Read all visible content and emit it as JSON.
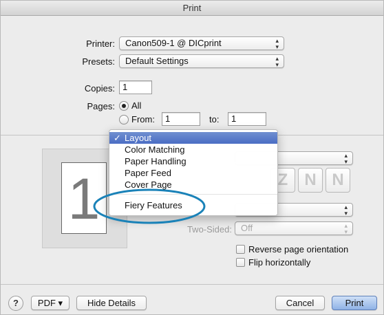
{
  "window": {
    "title": "Print"
  },
  "printer": {
    "label": "Printer:",
    "value": "Canon509-1 @ DICprint"
  },
  "presets": {
    "label": "Presets:",
    "value": "Default Settings"
  },
  "copies": {
    "label": "Copies:",
    "value": "1"
  },
  "pages": {
    "label": "Pages:",
    "all_label": "All",
    "from_label": "From:",
    "from_value": "1",
    "to_label": "to:",
    "to_value": "1",
    "selected": "All"
  },
  "preview": {
    "page_number": "1"
  },
  "section_menu": {
    "items": [
      {
        "label": "Layout",
        "checked": true,
        "checkmark": "✓"
      },
      {
        "label": "Color Matching"
      },
      {
        "label": "Paper Handling"
      },
      {
        "label": "Paper Feed"
      },
      {
        "label": "Cover Page"
      },
      {
        "label": "Fiery Features"
      }
    ],
    "highlight_color": "#1a82b8"
  },
  "layout_panel": {
    "two_sided_label": "Two-Sided:",
    "two_sided_value": "Off",
    "reverse_label": "Reverse page orientation",
    "flip_label": "Flip horizontally",
    "layout_direction_icons": [
      "Z",
      "N",
      "N"
    ]
  },
  "bottom_bar": {
    "help": "?",
    "pdf": "PDF ▾",
    "hide_details": "Hide Details",
    "cancel": "Cancel",
    "print": "Print"
  },
  "icons": {
    "popup_arrows": "▴▾",
    "help": "question-icon"
  }
}
